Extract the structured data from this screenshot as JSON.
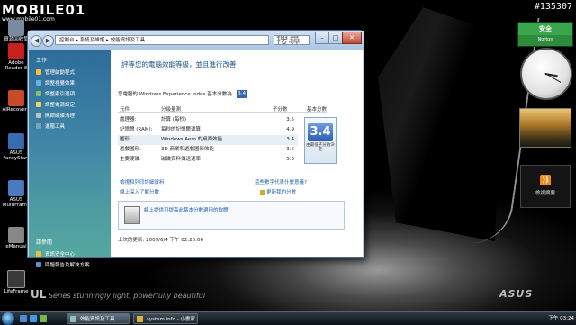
{
  "watermark": {
    "brand": "MOBILE01",
    "sub": "www.mobile01.com"
  },
  "image_id": "#135307",
  "desktop_icons": [
    {
      "label": "資源回收筒",
      "color": "#7a8aa0"
    },
    {
      "label": "Adobe Reader 8",
      "color": "#c8201e"
    },
    {
      "label": "AIRecovery",
      "color": "#c84a2a"
    },
    {
      "label": "ASUS FancyStart",
      "color": "#3a6ab0"
    },
    {
      "label": "ASUS MultiFrame",
      "color": "#4a7ac0"
    },
    {
      "label": "eManual",
      "color": "#888888"
    },
    {
      "label": "LifeFrame",
      "color": "#3a3a3a"
    }
  ],
  "slogan": {
    "brand": "UL",
    "series": "Series",
    "text": "stunningly light, powerfully beautiful"
  },
  "asus_logo": "ASUS",
  "gadgets": {
    "norton": {
      "status": "安全",
      "name": "Norton"
    },
    "clock": {
      "hour": 3,
      "minute": 20
    },
    "rss": {
      "label": "檢視摘要"
    }
  },
  "window": {
    "address": [
      "控制台",
      "系統及維護",
      "效能資訊及工具"
    ],
    "search_placeholder": "搜尋",
    "controls": {
      "min": "–",
      "max": "□",
      "close": "✕"
    },
    "nav": {
      "back": "◀",
      "forward": "▶"
    },
    "left_pane": {
      "heading": "工作",
      "items": [
        {
          "label": "管理啟動程式",
          "color": "#f0c040"
        },
        {
          "label": "調整視覺效果",
          "color": "#6ab0e0"
        },
        {
          "label": "調整索引選項",
          "color": "#80c070"
        },
        {
          "label": "調整電源設定",
          "color": "#f0d060"
        },
        {
          "label": "開啟磁碟清理",
          "color": "#c0c0c0"
        },
        {
          "label": "進階工具",
          "color": "#80a0c0"
        }
      ],
      "see_also_heading": "請參閱",
      "see_also": [
        {
          "label": "資訊安全中心",
          "color": "#e0c040"
        },
        {
          "label": "問題報告及解決方案",
          "color": "#6090d0"
        }
      ]
    },
    "content": {
      "title": "評等您的電腦效能等級，並且進行改善",
      "rating_text": "您電腦的 Windows Experience Index 基本分數為",
      "rating_badge": "3.4",
      "headers": {
        "component": "元件",
        "rated": "分級量測",
        "subscore": "子分數",
        "base": "基本分數"
      },
      "rows": [
        {
          "component": "處理器:",
          "rated": "計算 (每秒)",
          "subscore": "3.5"
        },
        {
          "component": "記憶體 (RAM):",
          "rated": "每秒的記憶體運算",
          "subscore": "4.9"
        },
        {
          "component": "圖形:",
          "rated": "Windows Aero 的桌面效能",
          "subscore": "3.4"
        },
        {
          "component": "遊戲圖形:",
          "rated": "3D 商業和遊戲圖形效能",
          "subscore": "3.5"
        },
        {
          "component": "主要硬碟:",
          "rated": "磁碟資料傳送速率",
          "subscore": "5.6"
        }
      ],
      "base_score": "3.4",
      "base_caption": "由最低子分數決定",
      "links": {
        "print": "檢視和列印詳細資料",
        "what_mean": "這些數字代表什麼意義?",
        "learn_more": "線上深入了解分數",
        "update": "更新我的分數"
      },
      "infobox_text": "線上提供可提高此基本分數適用的軟體",
      "last_update": "上次的更新: 2009/6/4 下午 02:20:06"
    }
  },
  "taskbar": {
    "windows": [
      {
        "label": "效能資訊及工具",
        "active": true
      },
      {
        "label": "system info - 小畫家",
        "active": false
      }
    ],
    "time": "下午 03:24"
  }
}
